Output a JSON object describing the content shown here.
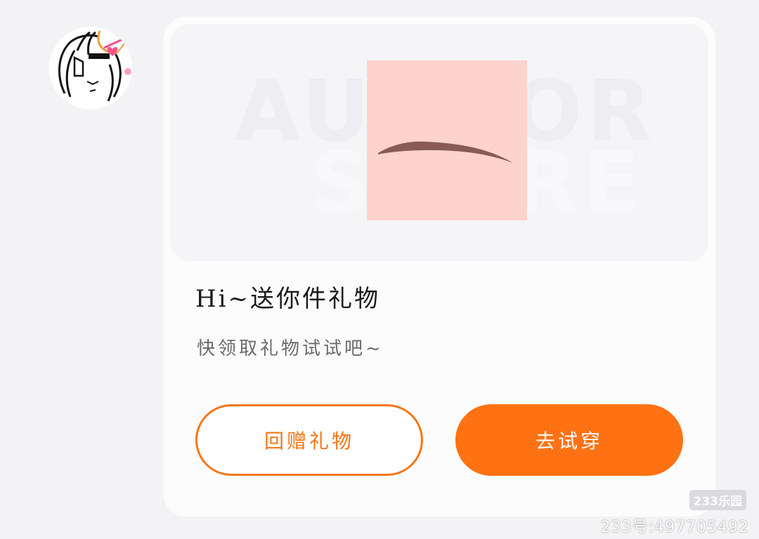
{
  "avatar": {
    "icon": "hand-drawn-character-avatar"
  },
  "banner": {
    "watermark_line1": "AUTHOR",
    "watermark_line2": "STORE",
    "item_icon": "eyebrow-item-icon"
  },
  "gift": {
    "title": "Hi~送你件礼物",
    "subtitle": "快领取礼物试试吧~"
  },
  "actions": {
    "return_gift_label": "回赠礼物",
    "try_on_label": "去试穿"
  },
  "watermark": {
    "brand": "233乐园",
    "account_id": "233号:497705492"
  },
  "colors": {
    "accent": "#ff7213",
    "item_background": "#fdd3cc",
    "eyebrow": "#8a5a56"
  }
}
